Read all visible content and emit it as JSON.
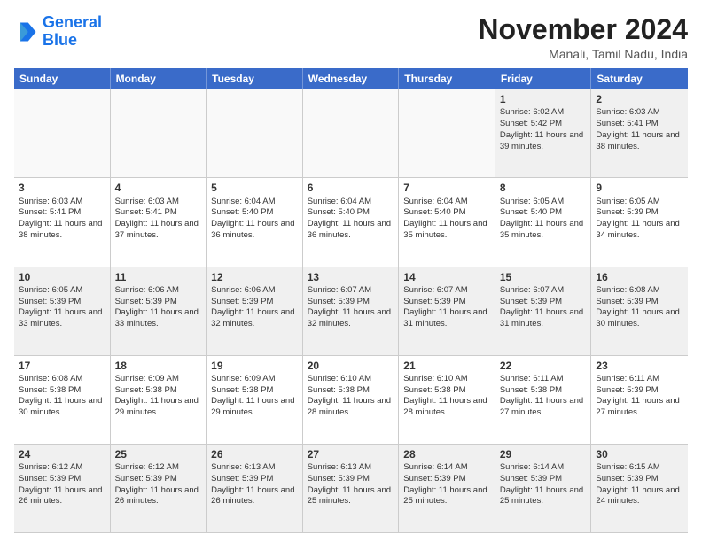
{
  "logo": {
    "line1": "General",
    "line2": "Blue"
  },
  "title": "November 2024",
  "location": "Manali, Tamil Nadu, India",
  "weekdays": [
    "Sunday",
    "Monday",
    "Tuesday",
    "Wednesday",
    "Thursday",
    "Friday",
    "Saturday"
  ],
  "weeks": [
    [
      {
        "day": "",
        "info": ""
      },
      {
        "day": "",
        "info": ""
      },
      {
        "day": "",
        "info": ""
      },
      {
        "day": "",
        "info": ""
      },
      {
        "day": "",
        "info": ""
      },
      {
        "day": "1",
        "info": "Sunrise: 6:02 AM\nSunset: 5:42 PM\nDaylight: 11 hours and 39 minutes."
      },
      {
        "day": "2",
        "info": "Sunrise: 6:03 AM\nSunset: 5:41 PM\nDaylight: 11 hours and 38 minutes."
      }
    ],
    [
      {
        "day": "3",
        "info": "Sunrise: 6:03 AM\nSunset: 5:41 PM\nDaylight: 11 hours and 38 minutes."
      },
      {
        "day": "4",
        "info": "Sunrise: 6:03 AM\nSunset: 5:41 PM\nDaylight: 11 hours and 37 minutes."
      },
      {
        "day": "5",
        "info": "Sunrise: 6:04 AM\nSunset: 5:40 PM\nDaylight: 11 hours and 36 minutes."
      },
      {
        "day": "6",
        "info": "Sunrise: 6:04 AM\nSunset: 5:40 PM\nDaylight: 11 hours and 36 minutes."
      },
      {
        "day": "7",
        "info": "Sunrise: 6:04 AM\nSunset: 5:40 PM\nDaylight: 11 hours and 35 minutes."
      },
      {
        "day": "8",
        "info": "Sunrise: 6:05 AM\nSunset: 5:40 PM\nDaylight: 11 hours and 35 minutes."
      },
      {
        "day": "9",
        "info": "Sunrise: 6:05 AM\nSunset: 5:39 PM\nDaylight: 11 hours and 34 minutes."
      }
    ],
    [
      {
        "day": "10",
        "info": "Sunrise: 6:05 AM\nSunset: 5:39 PM\nDaylight: 11 hours and 33 minutes."
      },
      {
        "day": "11",
        "info": "Sunrise: 6:06 AM\nSunset: 5:39 PM\nDaylight: 11 hours and 33 minutes."
      },
      {
        "day": "12",
        "info": "Sunrise: 6:06 AM\nSunset: 5:39 PM\nDaylight: 11 hours and 32 minutes."
      },
      {
        "day": "13",
        "info": "Sunrise: 6:07 AM\nSunset: 5:39 PM\nDaylight: 11 hours and 32 minutes."
      },
      {
        "day": "14",
        "info": "Sunrise: 6:07 AM\nSunset: 5:39 PM\nDaylight: 11 hours and 31 minutes."
      },
      {
        "day": "15",
        "info": "Sunrise: 6:07 AM\nSunset: 5:39 PM\nDaylight: 11 hours and 31 minutes."
      },
      {
        "day": "16",
        "info": "Sunrise: 6:08 AM\nSunset: 5:39 PM\nDaylight: 11 hours and 30 minutes."
      }
    ],
    [
      {
        "day": "17",
        "info": "Sunrise: 6:08 AM\nSunset: 5:38 PM\nDaylight: 11 hours and 30 minutes."
      },
      {
        "day": "18",
        "info": "Sunrise: 6:09 AM\nSunset: 5:38 PM\nDaylight: 11 hours and 29 minutes."
      },
      {
        "day": "19",
        "info": "Sunrise: 6:09 AM\nSunset: 5:38 PM\nDaylight: 11 hours and 29 minutes."
      },
      {
        "day": "20",
        "info": "Sunrise: 6:10 AM\nSunset: 5:38 PM\nDaylight: 11 hours and 28 minutes."
      },
      {
        "day": "21",
        "info": "Sunrise: 6:10 AM\nSunset: 5:38 PM\nDaylight: 11 hours and 28 minutes."
      },
      {
        "day": "22",
        "info": "Sunrise: 6:11 AM\nSunset: 5:38 PM\nDaylight: 11 hours and 27 minutes."
      },
      {
        "day": "23",
        "info": "Sunrise: 6:11 AM\nSunset: 5:39 PM\nDaylight: 11 hours and 27 minutes."
      }
    ],
    [
      {
        "day": "24",
        "info": "Sunrise: 6:12 AM\nSunset: 5:39 PM\nDaylight: 11 hours and 26 minutes."
      },
      {
        "day": "25",
        "info": "Sunrise: 6:12 AM\nSunset: 5:39 PM\nDaylight: 11 hours and 26 minutes."
      },
      {
        "day": "26",
        "info": "Sunrise: 6:13 AM\nSunset: 5:39 PM\nDaylight: 11 hours and 26 minutes."
      },
      {
        "day": "27",
        "info": "Sunrise: 6:13 AM\nSunset: 5:39 PM\nDaylight: 11 hours and 25 minutes."
      },
      {
        "day": "28",
        "info": "Sunrise: 6:14 AM\nSunset: 5:39 PM\nDaylight: 11 hours and 25 minutes."
      },
      {
        "day": "29",
        "info": "Sunrise: 6:14 AM\nSunset: 5:39 PM\nDaylight: 11 hours and 25 minutes."
      },
      {
        "day": "30",
        "info": "Sunrise: 6:15 AM\nSunset: 5:39 PM\nDaylight: 11 hours and 24 minutes."
      }
    ]
  ]
}
